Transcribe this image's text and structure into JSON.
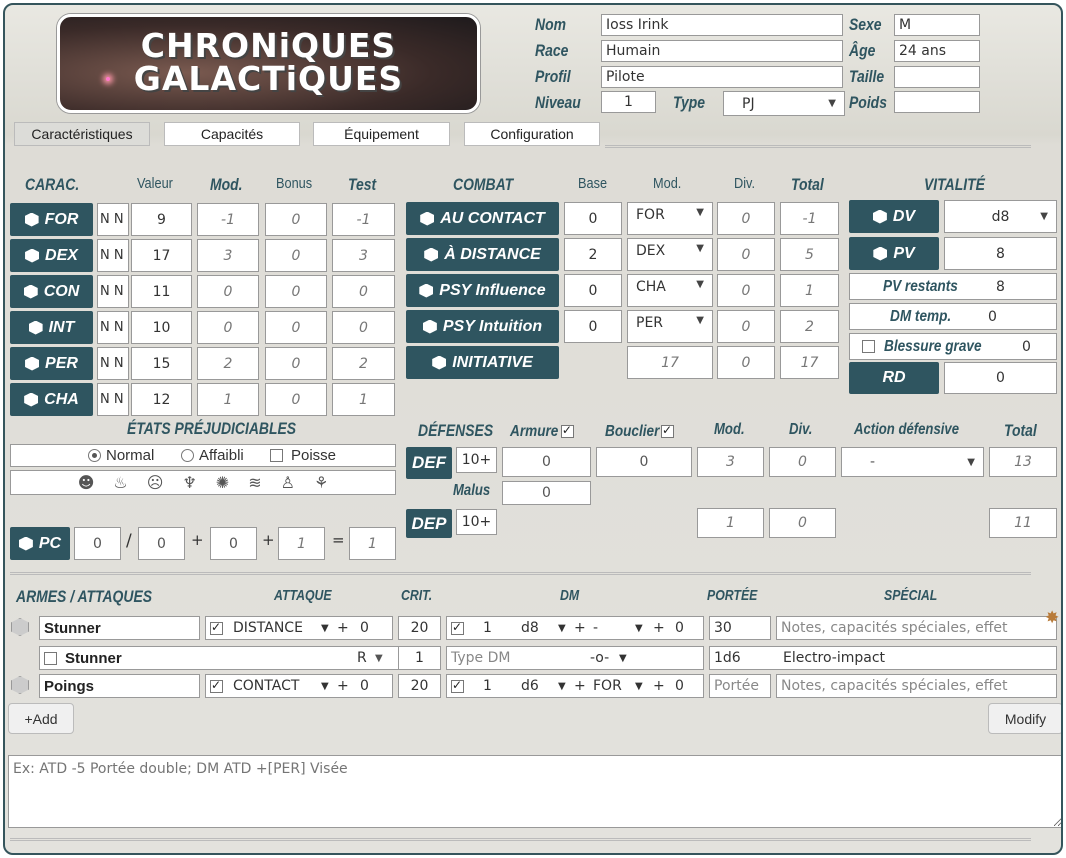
{
  "logo": {
    "line1": "CHRONiQUES",
    "line2": "GALACTiQUES"
  },
  "identity": {
    "nom_label": "Nom",
    "nom": "Ioss Irink",
    "race_label": "Race",
    "race": "Humain",
    "profil_label": "Profil",
    "profil": "Pilote",
    "niveau_label": "Niveau",
    "niveau": "1",
    "type_label": "Type",
    "type": "PJ",
    "sexe_label": "Sexe",
    "sexe": "M",
    "age_label": "Âge",
    "age": "24 ans",
    "taille_label": "Taille",
    "taille": "",
    "poids_label": "Poids",
    "poids": ""
  },
  "tabs": [
    "Caractéristiques",
    "Capacités",
    "Équipement",
    "Configuration"
  ],
  "carac": {
    "headers": [
      "CARAC.",
      "Valeur",
      "Mod.",
      "Bonus",
      "Test"
    ],
    "rows": [
      {
        "name": "FOR",
        "nm": "N N",
        "valeur": "9",
        "mod": "-1",
        "bonus": "0",
        "test": "-1"
      },
      {
        "name": "DEX",
        "nm": "N N",
        "valeur": "17",
        "mod": "3",
        "bonus": "0",
        "test": "3"
      },
      {
        "name": "CON",
        "nm": "N N",
        "valeur": "11",
        "mod": "0",
        "bonus": "0",
        "test": "0"
      },
      {
        "name": "INT",
        "nm": "N N",
        "valeur": "10",
        "mod": "0",
        "bonus": "0",
        "test": "0"
      },
      {
        "name": "PER",
        "nm": "N N",
        "valeur": "15",
        "mod": "2",
        "bonus": "0",
        "test": "2"
      },
      {
        "name": "CHA",
        "nm": "N N",
        "valeur": "12",
        "mod": "1",
        "bonus": "0",
        "test": "1"
      }
    ]
  },
  "combat": {
    "headers": [
      "COMBAT",
      "Base",
      "Mod.",
      "Div.",
      "Total"
    ],
    "rows": [
      {
        "name": "AU CONTACT",
        "base": "0",
        "mod": "FOR",
        "div": "0",
        "total": "-1"
      },
      {
        "name": "À DISTANCE",
        "base": "2",
        "mod": "DEX",
        "div": "0",
        "total": "5"
      },
      {
        "name": "PSY Influence",
        "base": "0",
        "mod": "CHA",
        "div": "0",
        "total": "1"
      },
      {
        "name": "PSY Intuition",
        "base": "0",
        "mod": "PER",
        "div": "0",
        "total": "2"
      },
      {
        "name": "INITIATIVE",
        "base": "",
        "mod": "17",
        "div": "0",
        "total": "17"
      }
    ]
  },
  "vitalite": {
    "title": "VITALITÉ",
    "dv_label": "DV",
    "dv": "d8",
    "pv_label": "PV",
    "pv": "8",
    "pv_restants_label": "PV restants",
    "pv_restants": "8",
    "dm_temp_label": "DM temp.",
    "dm_temp": "0",
    "blessure_label": "Blessure grave",
    "blessure": "0",
    "rd_label": "RD",
    "rd": "0"
  },
  "etats": {
    "title": "ÉTATS PRÉJUDICIABLES",
    "options": [
      "Normal",
      "Affaibli",
      "Poisse"
    ],
    "icons": [
      "blinded-icon",
      "fear-icon",
      "stunned-icon",
      "immobilized-icon",
      "surprised-icon",
      "slowed-icon",
      "weakened-icon",
      "prone-icon"
    ]
  },
  "pc": {
    "label": "PC",
    "v1": "0",
    "sep1": "/",
    "v2": "0",
    "plus1": "+",
    "v3": "0",
    "plus2": "+",
    "v4": "1",
    "eq": "=",
    "total": "1"
  },
  "defenses": {
    "title": "DÉFENSES",
    "armure_label": "Armure",
    "bouclier_label": "Bouclier",
    "mod_label": "Mod.",
    "div_label": "Div.",
    "action_label": "Action défensive",
    "total_label": "Total",
    "def_label": "DEF",
    "def_base": "10+",
    "armure": "0",
    "bouclier": "0",
    "def_mod": "3",
    "def_div": "0",
    "action": "-",
    "def_total": "13",
    "malus_label": "Malus",
    "malus": "0",
    "dep_label": "DEP",
    "dep_base": "10+",
    "dep_mod": "1",
    "dep_div": "0",
    "dep_total": "11"
  },
  "armes": {
    "headers": [
      "ARMES / ATTAQUES",
      "ATTAQUE",
      "CRIT.",
      "DM",
      "PORTÉE",
      "SPÉCIAL"
    ],
    "rows": [
      {
        "name": "Stunner",
        "attaque": "DISTANCE",
        "plus": "+",
        "att_bonus": "0",
        "crit": "20",
        "dm_n": "1",
        "dm_d": "d8",
        "dm_plus": "+",
        "dm_mod": "-",
        "dm_plus2": "+",
        "dm_bonus": "0",
        "portee": "30",
        "special": "Notes, capacités spéciales, effet"
      },
      {
        "name": "Poings",
        "attaque": "CONTACT",
        "plus": "+",
        "att_bonus": "0",
        "crit": "20",
        "dm_n": "1",
        "dm_d": "d6",
        "dm_plus": "+",
        "dm_mod": "FOR",
        "dm_plus2": "+",
        "dm_bonus": "0",
        "portee": "Portée",
        "special": "Notes, capacités spéciales, effet"
      }
    ],
    "sub": {
      "name": "Stunner",
      "r": "R",
      "n": "1",
      "type_dm": "Type DM",
      "o": "-o-",
      "portee": "1d6",
      "effet": "Electro-impact"
    }
  },
  "buttons": {
    "add": "+Add",
    "modify": "Modify"
  },
  "notes": {
    "placeholder": "Ex: ATD -5 Portée double; DM ATD +[PER] Visée"
  }
}
